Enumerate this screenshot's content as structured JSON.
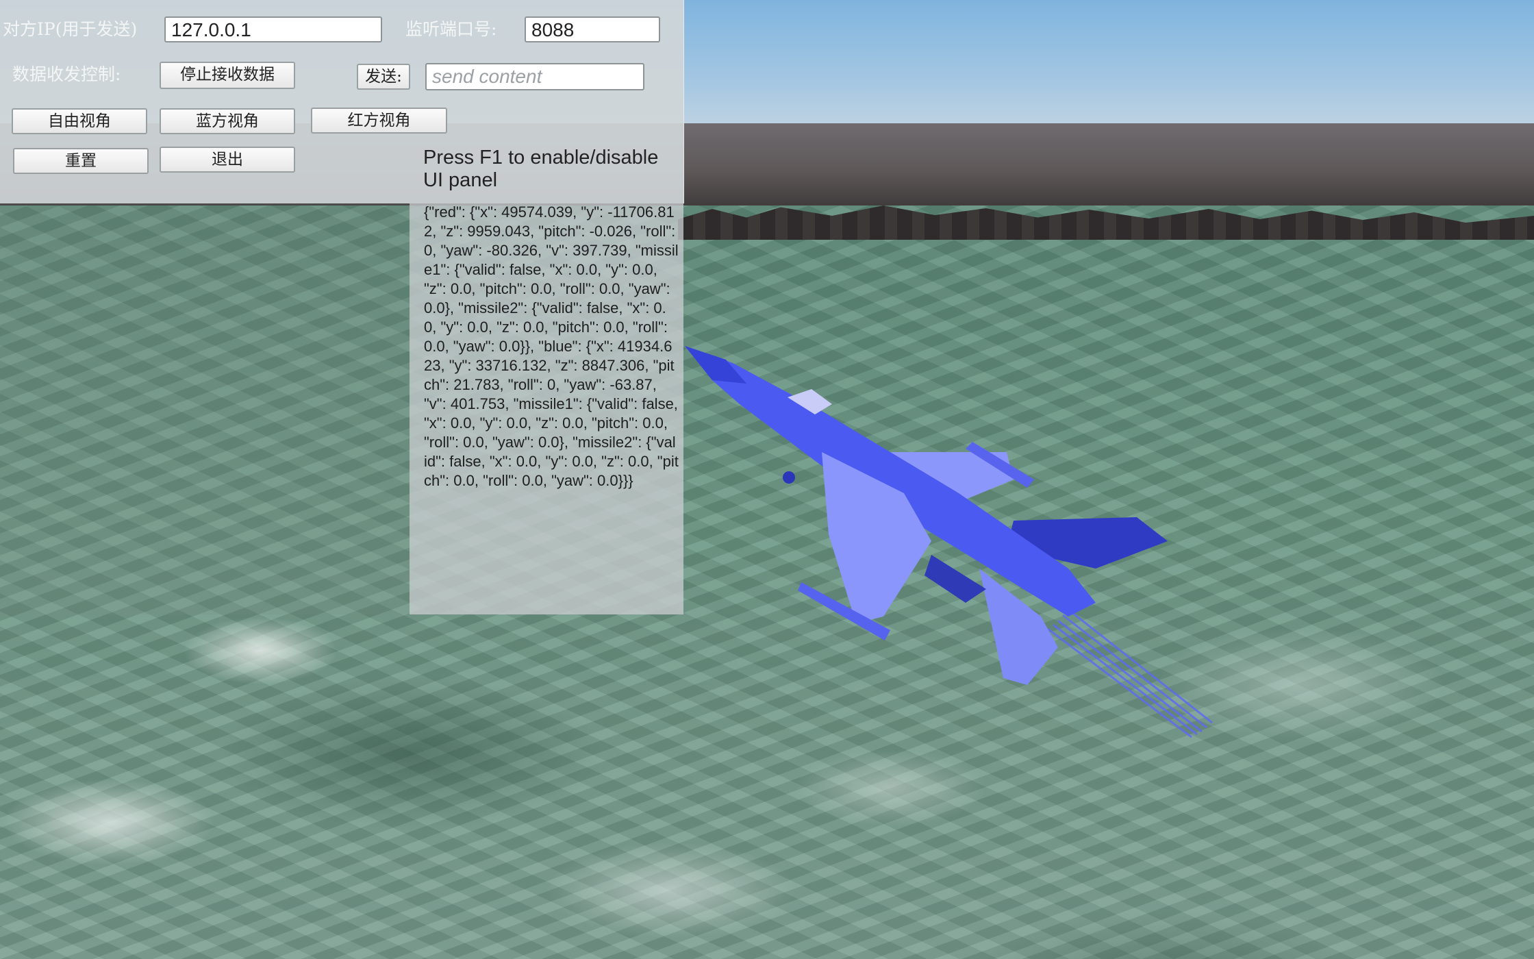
{
  "controls": {
    "peer_ip_label": "对方IP(用于发送)",
    "peer_ip_value": "127.0.0.1",
    "listen_port_label": "监听端口号:",
    "listen_port_value": "8088",
    "data_control_label": "数据收发控制:",
    "stop_receive_button": "停止接收数据",
    "send_button": "发送:",
    "send_placeholder": "send content"
  },
  "view_buttons": {
    "free_view": "自由视角",
    "blue_view": "蓝方视角",
    "red_view": "红方视角",
    "reset": "重置",
    "exit": "退出"
  },
  "info": {
    "hint": "Press F1 to enable/disable UI panel",
    "json": "{\"red\": {\"x\": 49574.039, \"y\": -11706.812, \"z\": 9959.043, \"pitch\": -0.026, \"roll\": 0, \"yaw\": -80.326, \"v\": 397.739, \"missile1\": {\"valid\": false, \"x\": 0.0, \"y\": 0.0, \"z\": 0.0, \"pitch\": 0.0, \"roll\": 0.0, \"yaw\": 0.0}, \"missile2\": {\"valid\": false, \"x\": 0.0, \"y\": 0.0, \"z\": 0.0, \"pitch\": 0.0, \"roll\": 0.0, \"yaw\": 0.0}}, \"blue\": {\"x\": 41934.623, \"y\": 33716.132, \"z\": 8847.306, \"pitch\": 21.783, \"roll\": 0, \"yaw\": -63.87, \"v\": 401.753, \"missile1\": {\"valid\": false, \"x\": 0.0, \"y\": 0.0, \"z\": 0.0, \"pitch\": 0.0, \"roll\": 0.0, \"yaw\": 0.0}, \"missile2\": {\"valid\": false, \"x\": 0.0, \"y\": 0.0, \"z\": 0.0, \"pitch\": 0.0, \"roll\": 0.0, \"yaw\": 0.0}}}"
  },
  "colors": {
    "aircraft_blue": "#4a5af0",
    "aircraft_dark": "#2c36b8",
    "aircraft_light": "#8f9cff"
  }
}
